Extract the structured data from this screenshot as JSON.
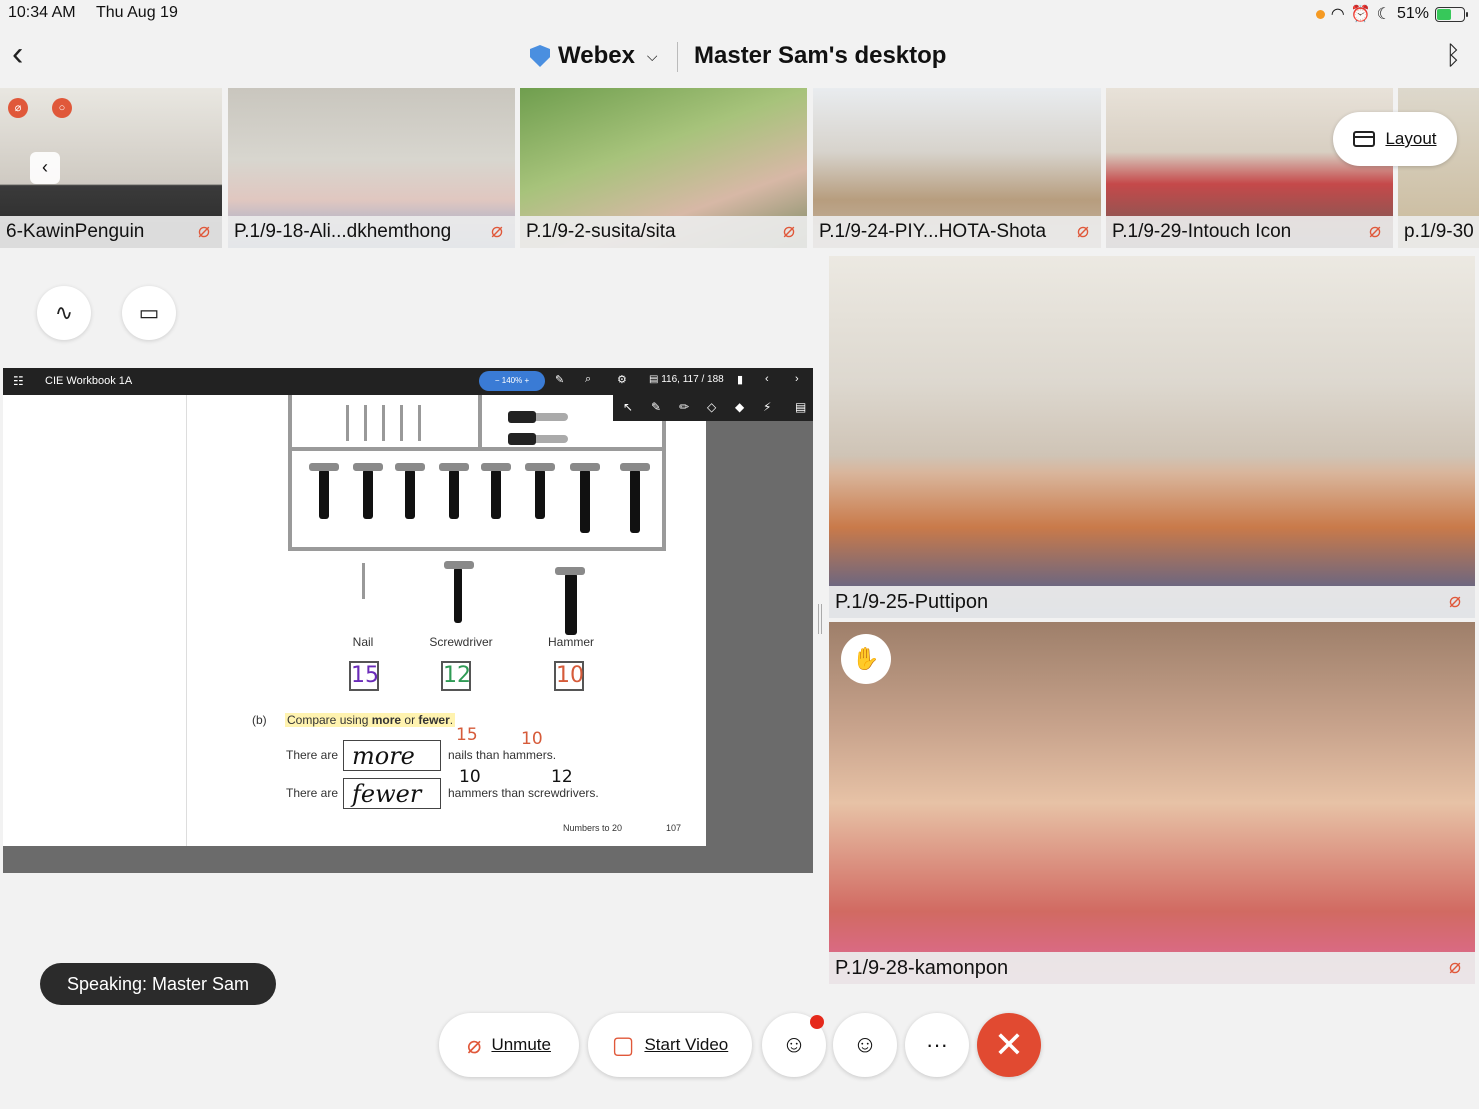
{
  "status_bar": {
    "time": "10:34 AM",
    "date": "Thu Aug 19",
    "battery": "51%"
  },
  "header": {
    "app_name": "Webex",
    "share_title": "Master Sam's desktop"
  },
  "strip": {
    "tiles": [
      {
        "name": "6-KawinPenguin"
      },
      {
        "name": "P.1/9-18-Ali...dkhemthong"
      },
      {
        "name": "P.1/9-2-susita/sita"
      },
      {
        "name": "P.1/9-24-PIY...HOTA-Shota"
      },
      {
        "name": "P.1/9-29-Intouch Icon"
      },
      {
        "name": "p.1/9-30"
      }
    ],
    "layout_label": "Layout"
  },
  "shared_doc": {
    "title": "CIE Workbook 1A",
    "zoom": "140%",
    "pages": "116, 117",
    "total_pages": "/ 188",
    "labels": {
      "nail": "Nail",
      "screwdriver": "Screwdriver",
      "hammer": "Hammer"
    },
    "counts": {
      "nail": "15",
      "screwdriver": "12",
      "hammer": "10"
    },
    "part": "(b)",
    "question_pre": "Compare using ",
    "question_more": "more",
    "question_or": " or ",
    "question_fewer": "fewer",
    "question_end": ".",
    "line1_pre": "There are",
    "line1_answer": "more",
    "line1_post": "nails than hammers.",
    "line1_n1": "15",
    "line1_n2": "10",
    "line2_pre": "There are",
    "line2_answer": "fewer",
    "line2_post": "hammers than screwdrivers.",
    "line2_n1": "10",
    "line2_n2": "12",
    "footer_section": "Numbers to 20",
    "footer_page": "107"
  },
  "videos": [
    {
      "name": "P.1/9-25-Puttipon"
    },
    {
      "name": "P.1/9-28-kamonpon"
    }
  ],
  "speaking": "Speaking: Master Sam",
  "controls": {
    "unmute": "Unmute",
    "start_video": "Start Video",
    "more": "···"
  },
  "colors": {
    "accent_red": "#e14a31",
    "mic_off": "#e0583a",
    "count_purple": "#6a2bb8",
    "count_green": "#2f9a55",
    "count_orange": "#d65b3a"
  }
}
